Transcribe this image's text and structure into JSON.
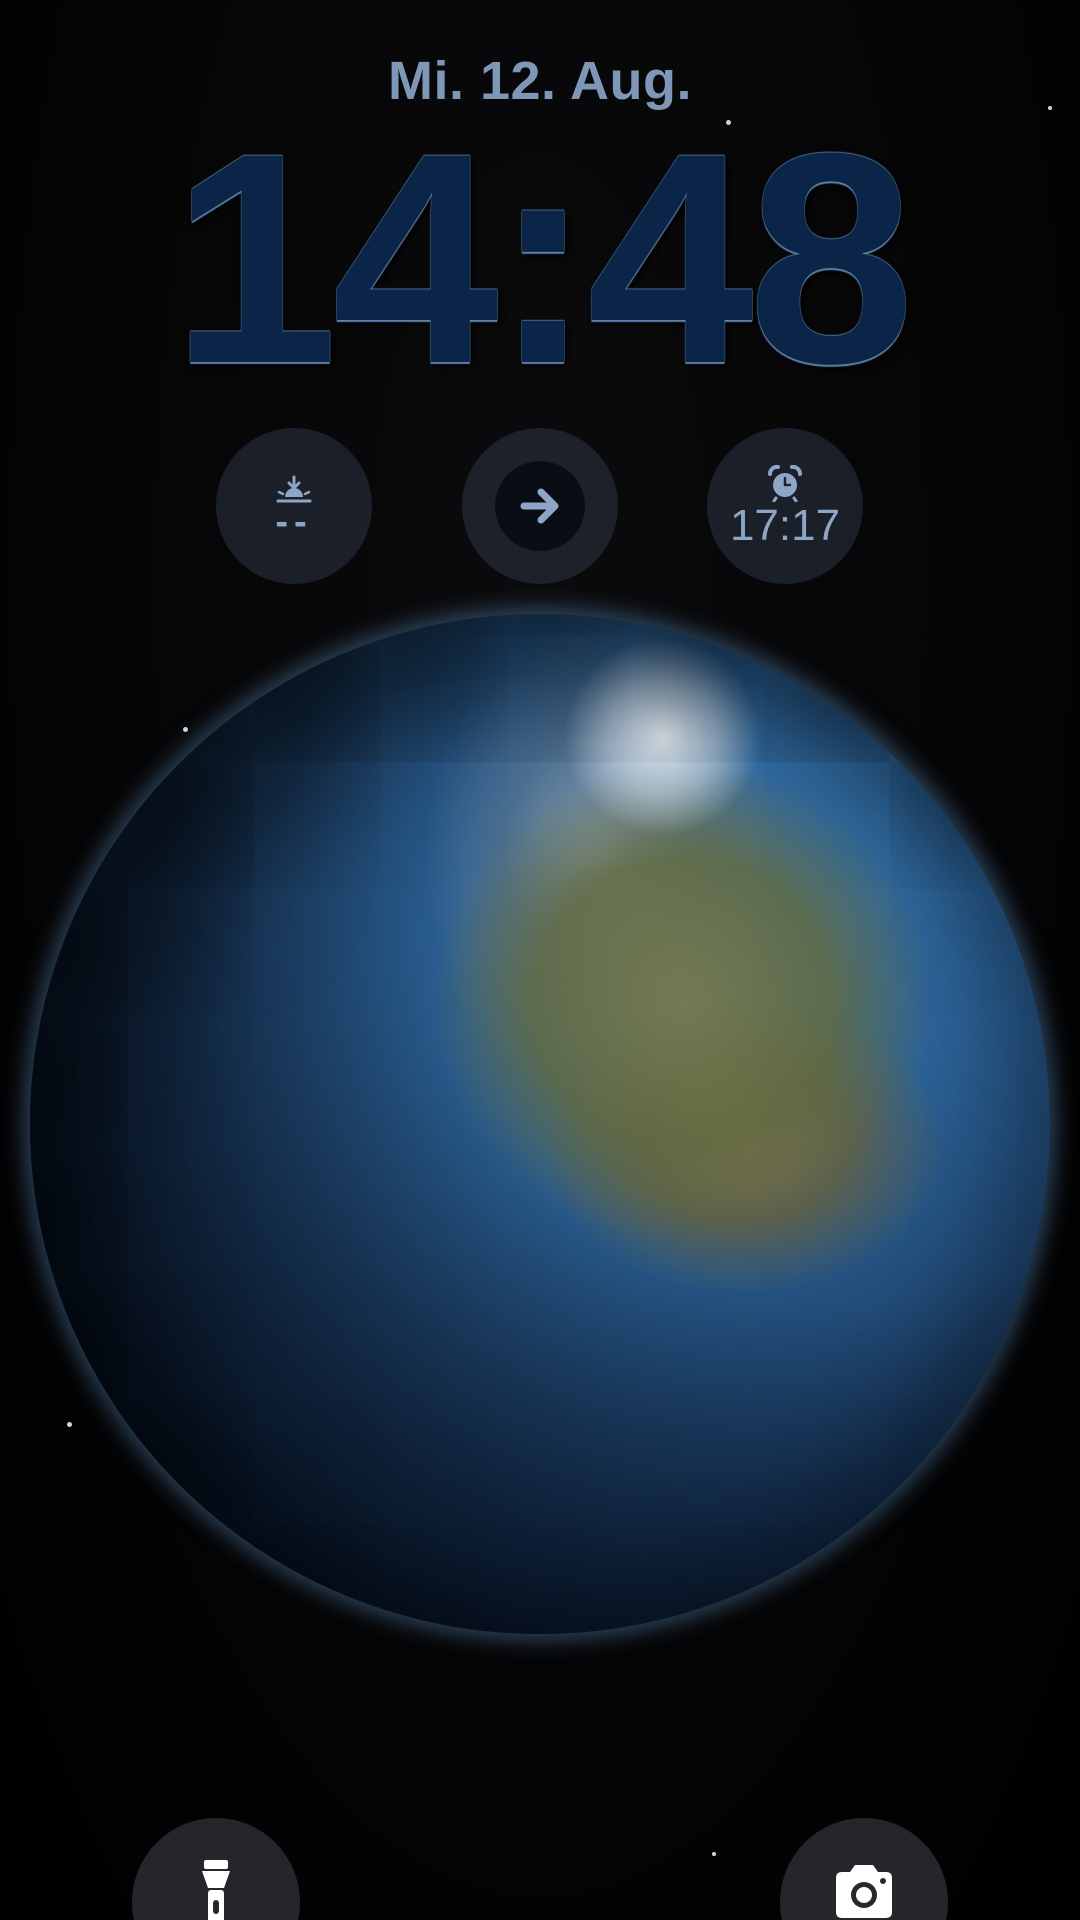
{
  "lockscreen": {
    "date": "Mi. 12. Aug.",
    "time": "14:48"
  },
  "widgets": {
    "sunrise": {
      "icon": "sunrise-icon",
      "value": "--"
    },
    "shortcut": {
      "icon": "arrow-right-icon"
    },
    "alarm": {
      "icon": "alarm-clock-icon",
      "value": "17:17"
    }
  },
  "bottom_buttons": {
    "flashlight": {
      "icon": "flashlight-icon"
    },
    "camera": {
      "icon": "camera-icon"
    }
  },
  "colors": {
    "date_text": "#7f97b6",
    "clock_fill": "#0b2548",
    "widget_text": "#8ea6c6",
    "background": "#000000"
  }
}
